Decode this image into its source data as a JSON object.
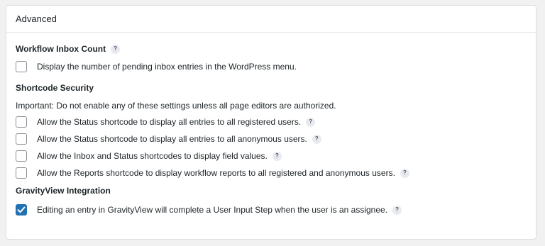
{
  "panel": {
    "title": "Advanced"
  },
  "inbox": {
    "title": "Workflow Inbox Count",
    "help": "?",
    "option_label": "Display the number of pending inbox entries in the WordPress menu.",
    "checked": false
  },
  "security": {
    "title": "Shortcode Security",
    "note": "Important: Do not enable any of these settings unless all page editors are authorized.",
    "options": [
      {
        "label": "Allow the Status shortcode to display all entries to all registered users.",
        "help": "?",
        "checked": false
      },
      {
        "label": "Allow the Status shortcode to display all entries to all anonymous users.",
        "help": "?",
        "checked": false
      },
      {
        "label": "Allow the Inbox and Status shortcodes to display field values.",
        "help": "?",
        "checked": false
      },
      {
        "label": "Allow the Reports shortcode to display workflow reports to all registered and anonymous users.",
        "help": "?",
        "checked": false
      }
    ]
  },
  "gravityview": {
    "title": "GravityView Integration",
    "option_label": "Editing an entry in GravityView will complete a User Input Step when the user is an assignee.",
    "help": "?",
    "checked": true
  },
  "colors": {
    "checkbox_checked": "#2271b1",
    "help_badge_bg": "#e8eaf0"
  }
}
